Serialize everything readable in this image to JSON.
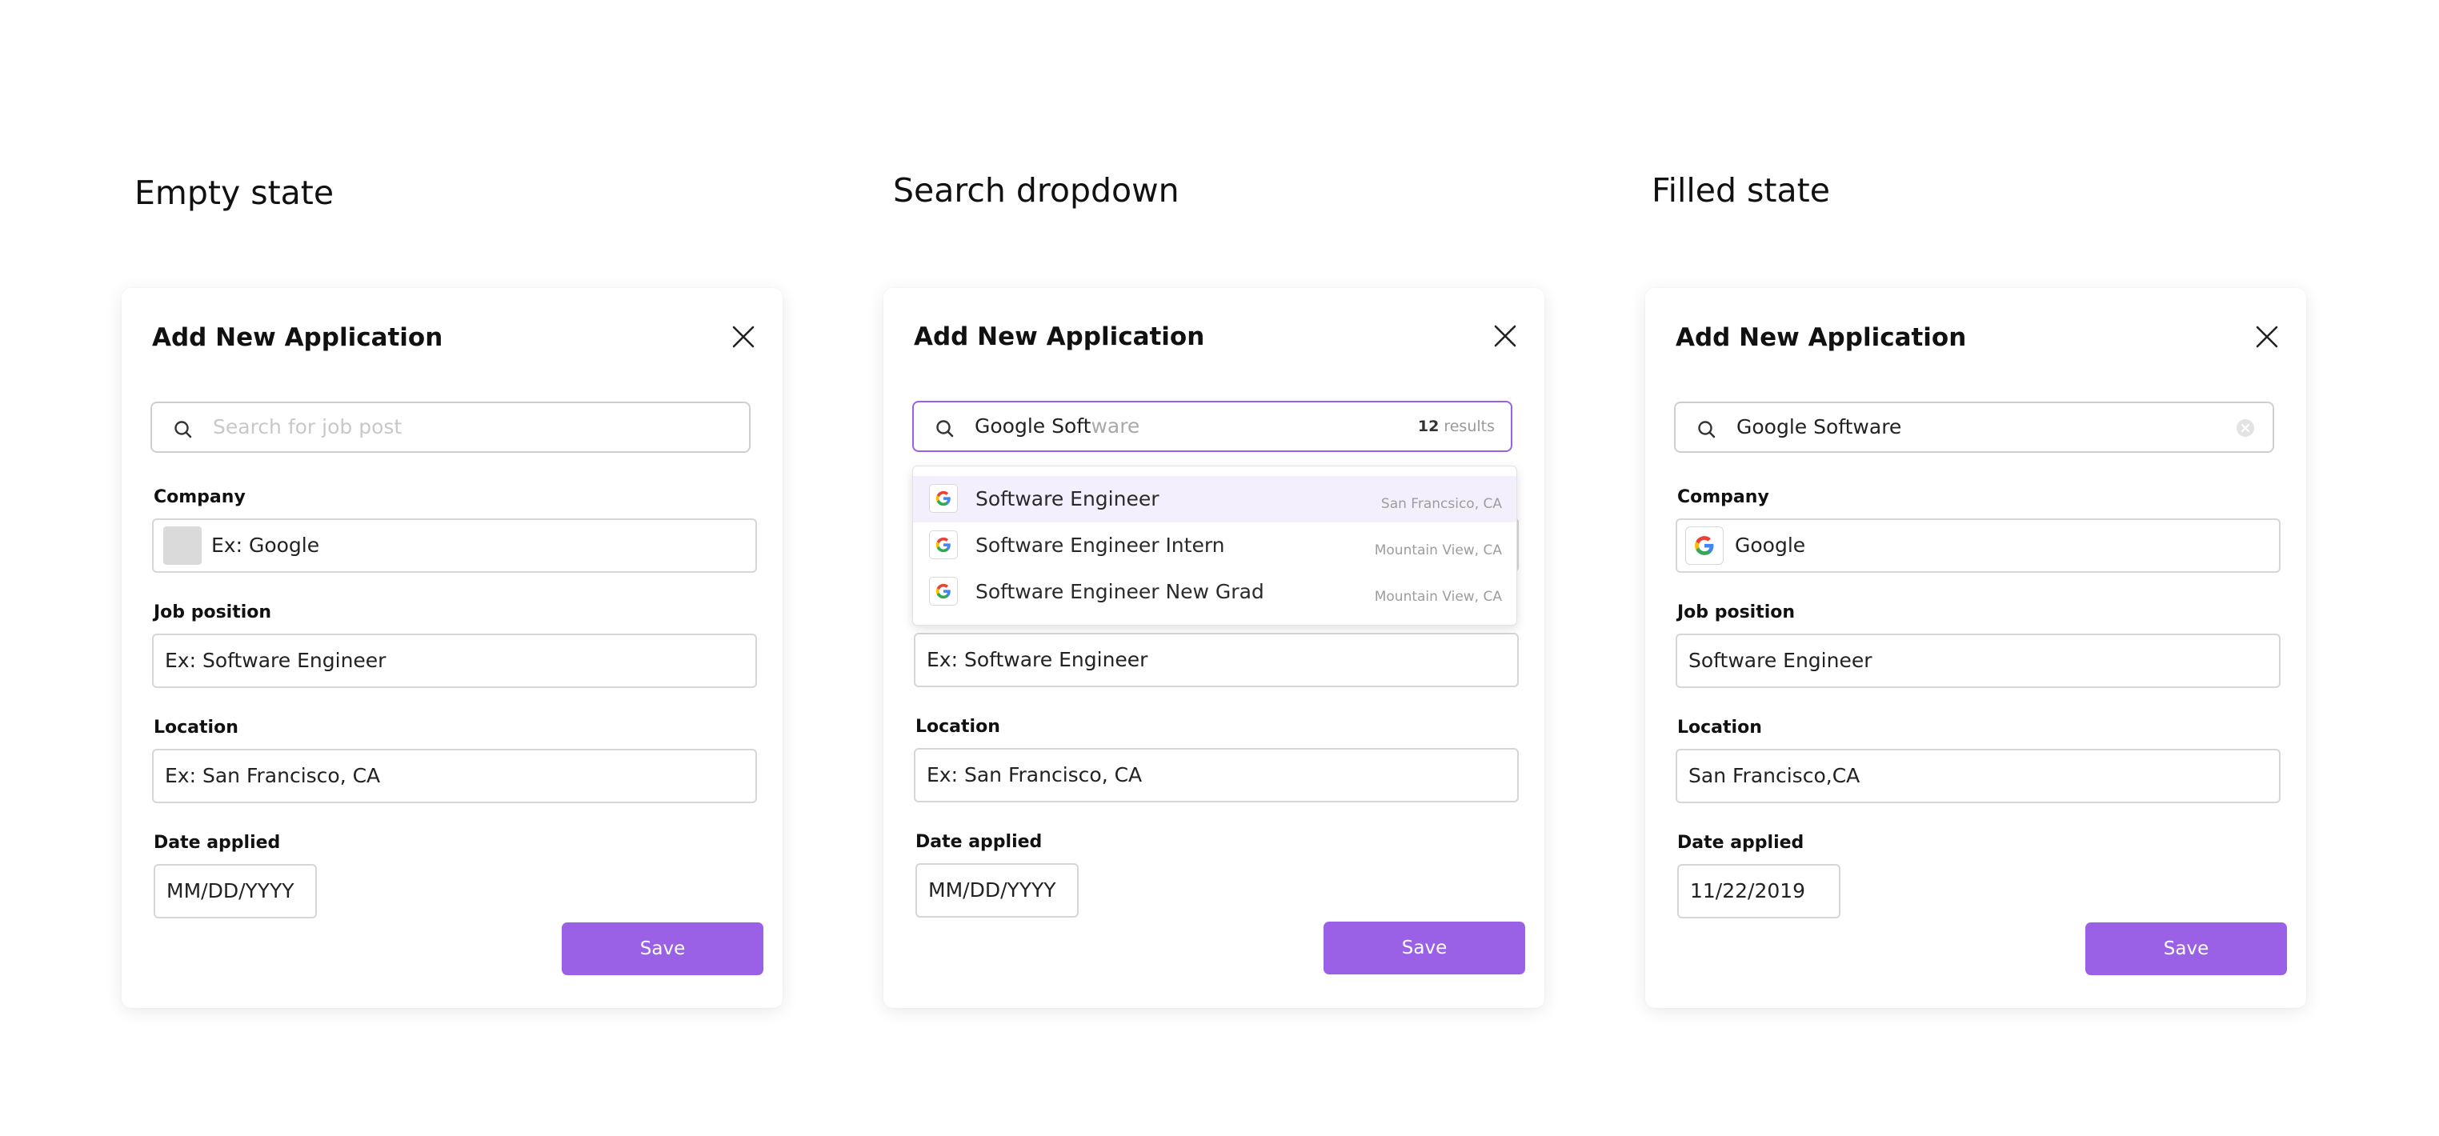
{
  "colors": {
    "accent": "#9a61e6",
    "highlight": "#f3effd",
    "border": "#d6d6d6"
  },
  "panels": [
    {
      "heading": "Empty state",
      "dialog_title": "Add New Application",
      "search": {
        "placeholder": "Search for job post"
      },
      "company": {
        "label": "Company",
        "placeholder": "Ex: Google"
      },
      "job_position": {
        "label": "Job position",
        "placeholder": "Ex: Software Engineer"
      },
      "location": {
        "label": "Location",
        "placeholder": "Ex: San Francisco, CA"
      },
      "date_applied": {
        "label": "Date applied",
        "placeholder": "MM/DD/YYYY"
      },
      "save_label": "Save"
    },
    {
      "heading": "Search dropdown",
      "dialog_title": "Add New Application",
      "search": {
        "typed": "Google Soft",
        "autocomplete": "ware",
        "results_count": "12",
        "results_label": "results"
      },
      "dropdown": [
        {
          "title": "Software Engineer",
          "location": "San Francsico, CA",
          "icon": "google-icon"
        },
        {
          "title": "Software Engineer Intern",
          "location": "Mountain View, CA",
          "icon": "google-icon"
        },
        {
          "title": "Software Engineer New Grad",
          "location": "Mountain View, CA",
          "icon": "google-icon"
        }
      ],
      "job_position": {
        "placeholder": "Ex: Software Engineer"
      },
      "location": {
        "label": "Location",
        "placeholder": "Ex: San Francisco, CA"
      },
      "date_applied": {
        "label": "Date applied",
        "placeholder": "MM/DD/YYYY"
      },
      "save_label": "Save"
    },
    {
      "heading": "Filled state",
      "dialog_title": "Add New Application",
      "search": {
        "value": "Google Software"
      },
      "company": {
        "label": "Company",
        "value": "Google",
        "icon": "google-icon"
      },
      "job_position": {
        "label": "Job position",
        "value": "Software Engineer"
      },
      "location": {
        "label": "Location",
        "value": "San Francisco,CA"
      },
      "date_applied": {
        "label": "Date applied",
        "value": "11/22/2019"
      },
      "save_label": "Save"
    }
  ]
}
